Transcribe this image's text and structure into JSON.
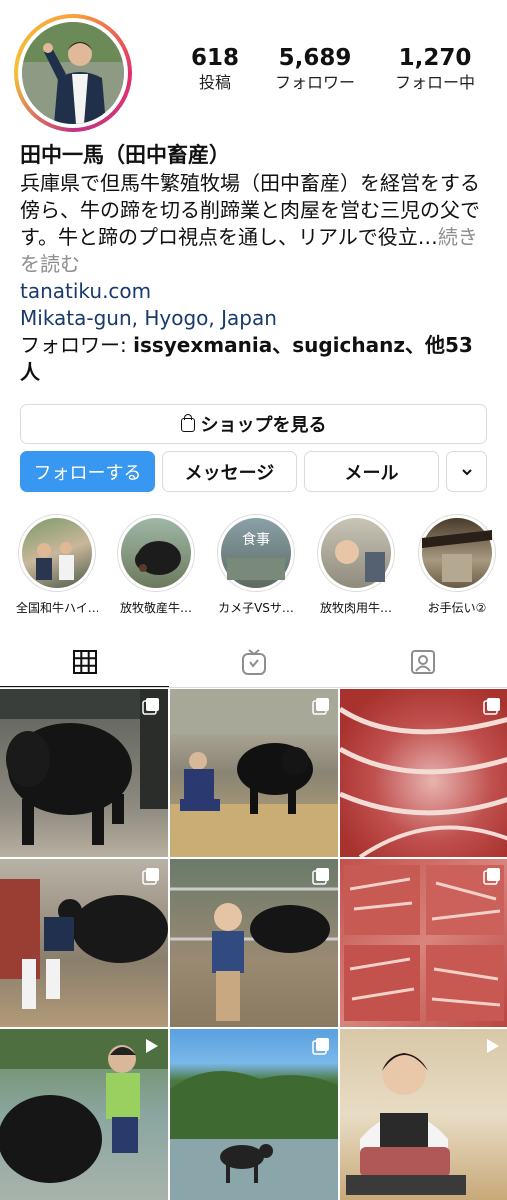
{
  "profile": {
    "name": "田中一馬（田中畜産）",
    "bio_text": "兵庫県で但馬牛繁殖牧場（田中畜産）を経営をする傍ら、牛の蹄を切る削蹄業と肉屋を営む三児の父です。牛と蹄のプロ視点を通し、リアルで役立…",
    "bio_more": "続きを読む",
    "website": "tanatiku.com",
    "location": "Mikata-gun, Hyogo, Japan",
    "followed_by_prefix": "フォロワー: ",
    "followed_by_names": "issyexmania、sugichanz、",
    "followed_by_suffix": "他53人"
  },
  "stats": {
    "posts": {
      "value": "618",
      "label": "投稿"
    },
    "followers": {
      "value": "5,689",
      "label": "フォロワー"
    },
    "following": {
      "value": "1,270",
      "label": "フォロー中"
    }
  },
  "buttons": {
    "shop": "ショップを見る",
    "follow": "フォローする",
    "message": "メッセージ",
    "mail": "メール"
  },
  "highlights": [
    {
      "label": "全国和牛ハイ…"
    },
    {
      "label": "放牧敬産牛…"
    },
    {
      "label": "カメ子VSサ…"
    },
    {
      "label": "放牧肉用牛…"
    },
    {
      "label": "お手伝い②"
    }
  ],
  "highlight_overlay_text": "食事",
  "tabs": [
    {
      "icon": "grid-icon",
      "active": true
    },
    {
      "icon": "igtv-icon",
      "active": false
    },
    {
      "icon": "tagged-icon",
      "active": false
    }
  ],
  "posts": [
    {
      "subject": "black cow in barn",
      "badge": "multiple-icon"
    },
    {
      "subject": "man kneeling with cow",
      "badge": "multiple-icon"
    },
    {
      "subject": "sliced wagyu beef",
      "badge": "multiple-icon"
    },
    {
      "subject": "hoof trimming",
      "badge": "multiple-icon"
    },
    {
      "subject": "child with cows",
      "badge": "multiple-icon"
    },
    {
      "subject": "marbled beef slices",
      "badge": "multiple-icon"
    },
    {
      "subject": "boy with cow in river",
      "badge": "video-icon"
    },
    {
      "subject": "cow by lake",
      "badge": "multiple-icon"
    },
    {
      "subject": "man with steak",
      "badge": "video-icon"
    }
  ],
  "colors": {
    "follow_button": "#3897f0",
    "link": "#1a3a6b",
    "muted": "#8e8e8e",
    "border": "#dbdbdb"
  }
}
